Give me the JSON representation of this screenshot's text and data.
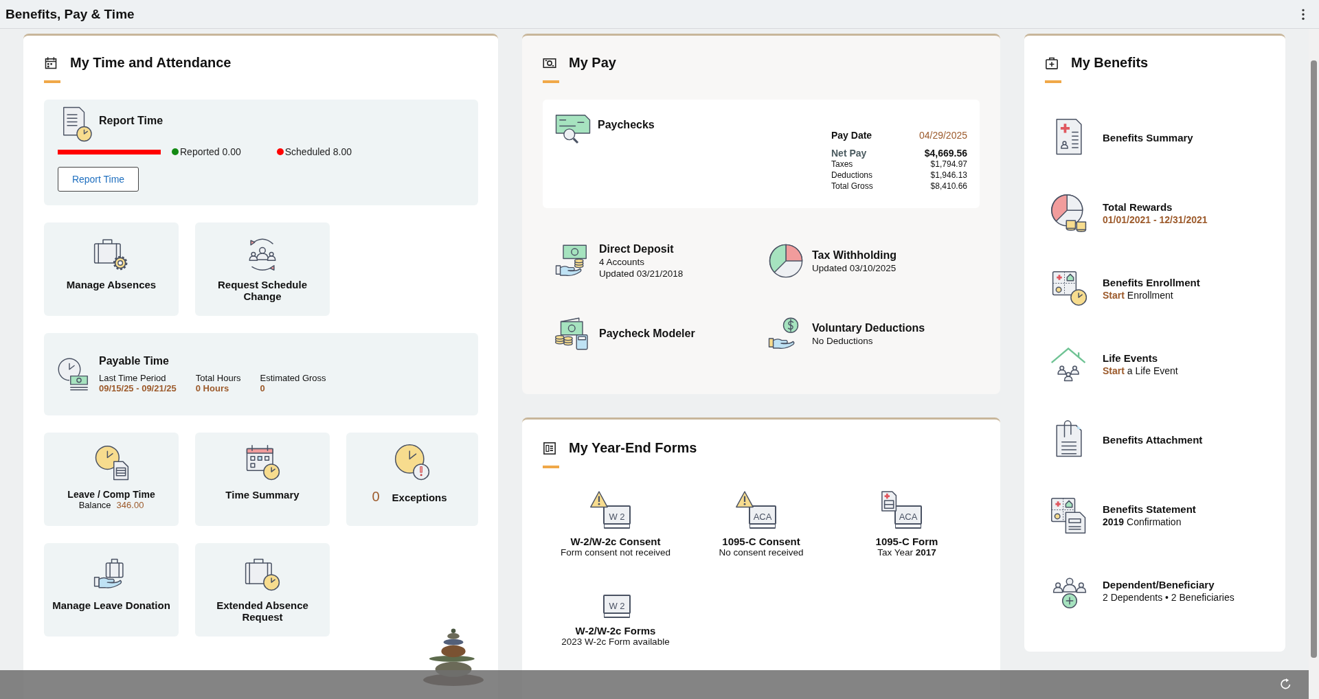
{
  "header": {
    "title": "Benefits, Pay & Time"
  },
  "time": {
    "title": "My Time and Attendance",
    "report": {
      "title": "Report Time",
      "level": 0,
      "legend": [
        {
          "label": "Reported 0.00",
          "color": "#138a13"
        },
        {
          "label": "Scheduled 8.00",
          "color": "#ff0000"
        }
      ],
      "button": "Report Time"
    },
    "tiles_a": [
      {
        "title": "Manage Absences"
      },
      {
        "title": "Request Schedule Change"
      }
    ],
    "payable": {
      "title": "Payable Time",
      "columns": [
        {
          "label": "Last Time Period",
          "value": "09/15/25 - 09/21/25"
        },
        {
          "label": "Total Hours",
          "value": "0 Hours"
        },
        {
          "label": "Estimated Gross",
          "value": "0"
        }
      ]
    },
    "tiles_b": [
      {
        "kind": "balance",
        "title": "Leave / Comp Time",
        "label": "Balance",
        "value": "346.00"
      },
      {
        "kind": "plain",
        "title": "Time Summary"
      },
      {
        "kind": "count",
        "count": "0",
        "title": "Exceptions"
      },
      {
        "kind": "plain",
        "title": "Manage Leave Donation"
      },
      {
        "kind": "plain",
        "title": "Extended Absence Request"
      }
    ]
  },
  "pay": {
    "title": "My Pay",
    "paychecks": {
      "title": "Paychecks",
      "rows": [
        {
          "kind": "date",
          "label": "Pay Date",
          "value": "04/29/2025"
        },
        {
          "kind": "net",
          "label": "Net Pay",
          "value": "$4,669.56"
        },
        {
          "kind": "normal",
          "label": "Taxes",
          "value": "$1,794.97"
        },
        {
          "kind": "normal",
          "label": "Deductions",
          "value": "$1,946.13"
        },
        {
          "kind": "normal",
          "label": "Total Gross",
          "value": "$8,410.66"
        }
      ]
    },
    "links": [
      {
        "title": "Direct Deposit",
        "lines": [
          "4 Accounts",
          "Updated 03/21/2018"
        ]
      },
      {
        "title": "Tax Withholding",
        "lines": [
          "Updated  03/10/2025"
        ]
      },
      {
        "title": "Paycheck Modeler"
      },
      {
        "title": "Voluntary Deductions",
        "lines": [
          "No Deductions"
        ]
      }
    ]
  },
  "forms": {
    "title": "My Year-End Forms",
    "items": [
      {
        "title": "W-2/W-2c Consent",
        "subtitle": "Form consent not received",
        "icon_text": "W 2",
        "kind": "warning"
      },
      {
        "title": "1095-C Consent",
        "subtitle": "No consent received",
        "icon_text": "ACA",
        "kind": "warning"
      },
      {
        "title": "1095-C Form",
        "subtitle": "Tax Year **2017**",
        "icon_text": "ACA",
        "kind": "document"
      },
      {
        "title": "W-2/W-2c Forms",
        "subtitle": "2023 W-2c Form available",
        "icon_text": "W 2"
      }
    ]
  },
  "benefits": {
    "title": "My Benefits",
    "items": [
      {
        "title": "Benefits Summary"
      },
      {
        "title": "Total Rewards",
        "subtitle": "01/01/2021 - 12/31/2021",
        "kind": "date"
      },
      {
        "title": "Benefits Enrollment",
        "subtitle": "**Start** Enrollment",
        "kind": "action"
      },
      {
        "title": "Life Events",
        "subtitle": "**Start** a Life Event",
        "kind": "action"
      },
      {
        "title": "Benefits Attachment"
      },
      {
        "title": "Benefits Statement",
        "subtitle": "**2019** Confirmation",
        "kind": "plain"
      },
      {
        "title": "Dependent/Beneficiary",
        "subtitle": "2 Dependents • 2 Beneficiaries",
        "kind": "plain"
      }
    ]
  }
}
